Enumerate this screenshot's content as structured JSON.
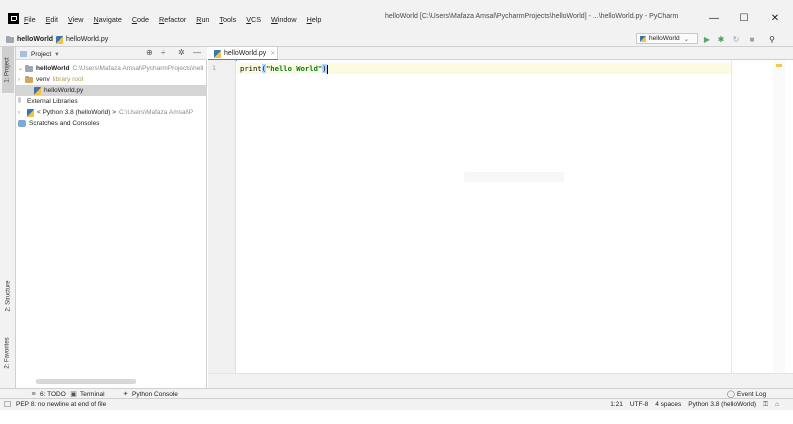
{
  "window": {
    "title": "helloWorld [C:\\Users\\Mafaza Amsal\\PycharmProjects\\helloWorld] - ...\\helloWorld.py - PyCharm",
    "minimize_label": "—",
    "maximize_label": "☐",
    "close_label": "✕"
  },
  "menu": [
    "File",
    "Edit",
    "View",
    "Navigate",
    "Code",
    "Refactor",
    "Run",
    "Tools",
    "VCS",
    "Window",
    "Help"
  ],
  "navbar": {
    "project_crumb": "helloWorld",
    "file_crumb": "helloWorld.py",
    "run_config": "helloWorld"
  },
  "left_stripe": {
    "project_tab": "1: Project",
    "structure_tab": "2: Structure",
    "favorites_tab": "2: Favorites"
  },
  "project_panel": {
    "header_label": "Project",
    "tree": [
      {
        "label": "helloWorld",
        "detail": "C:\\Users\\Mafaza Amsal\\PycharmProjects\\hell"
      },
      {
        "label": "venv",
        "detail": "library root"
      },
      {
        "label": "helloWorld.py",
        "detail": ""
      },
      {
        "label": "External Libraries",
        "detail": ""
      },
      {
        "label": "< Python 3.8 (helloWorld) >",
        "detail": "C:\\Users\\Mafaza Amsal\\P"
      },
      {
        "label": "Scratches and Consoles",
        "detail": ""
      }
    ]
  },
  "editor": {
    "tab_label": "helloWorld.py",
    "line_number": "1",
    "code_prefix": "print",
    "code_open": "(",
    "code_string": "\"hello World\"",
    "code_close": ")"
  },
  "bottom_tools": {
    "todo": "6: TODO",
    "terminal": "Terminal",
    "python_console": "Python Console",
    "event_log": "Event Log"
  },
  "status": {
    "message": "PEP 8: no newline at end of file",
    "position": "1:21",
    "encoding": "UTF-8",
    "indent": "4 spaces",
    "interpreter": "Python 3.8 (helloWorld)"
  },
  "colors": {
    "string": "#067d17",
    "tab_underline": "#4a86c7",
    "run_green": "#59a869",
    "debug_green": "#499c54"
  }
}
